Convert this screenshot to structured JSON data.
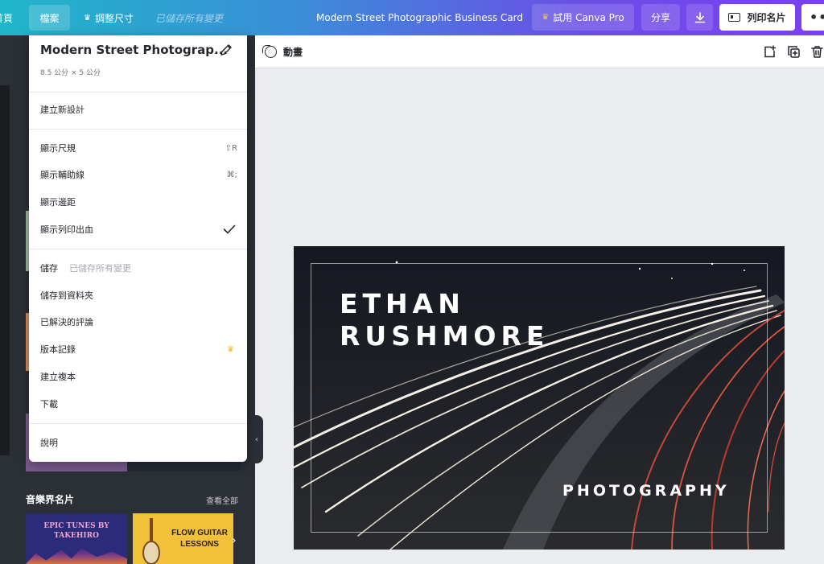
{
  "topbar": {
    "home_label": "首頁",
    "file_label": "檔案",
    "resize_label": "調整尺寸",
    "saved_status": "已儲存所有變更",
    "doc_title": "Modern Street Photographic Business Card",
    "pro_label": "試用 Canva Pro",
    "share_label": "分享",
    "print_label": "列印名片",
    "more_label": "•••"
  },
  "file_menu": {
    "title": "Modern Street Photograp...",
    "dimensions": "8.5 公分 × 5 公分",
    "create_new": "建立新設計",
    "show_rulers": "顯示尺規",
    "show_rulers_shortcut": "⇧R",
    "show_guides": "顯示輔助線",
    "show_guides_shortcut": "⌘;",
    "show_margins": "顯示邊距",
    "show_bleed": "顯示列印出血",
    "show_bleed_checked": true,
    "save": "儲存",
    "save_note": "已儲存所有變更",
    "save_to_folder": "儲存到資料夾",
    "resolved_comments": "已解決的評論",
    "version_history": "版本記錄",
    "make_copy": "建立複本",
    "download": "下載",
    "help": "說明"
  },
  "sidebar": {
    "music_section_title": "音樂界名片",
    "see_all": "查看全部",
    "template1_text": "EPIC TUNES BY TAKEHIRO",
    "template2_text": "FLOW GUITAR LESSONS"
  },
  "editor": {
    "animate_label": "動畫"
  },
  "card": {
    "name": "ETHAN\nRUSHMORE",
    "tagline": "PHOTOGRAPHY"
  },
  "colors": {
    "accent_gradient_start": "#1fb6c9",
    "accent_gradient_end": "#7b3ff0",
    "crown": "#f2b51d"
  },
  "icons": [
    "crown-icon",
    "download-icon",
    "card-icon",
    "more-icon",
    "pencil-icon",
    "check-icon",
    "animate-icon",
    "add-page-icon",
    "duplicate-icon",
    "trash-icon",
    "chevron-left-icon",
    "chevron-right-icon"
  ]
}
